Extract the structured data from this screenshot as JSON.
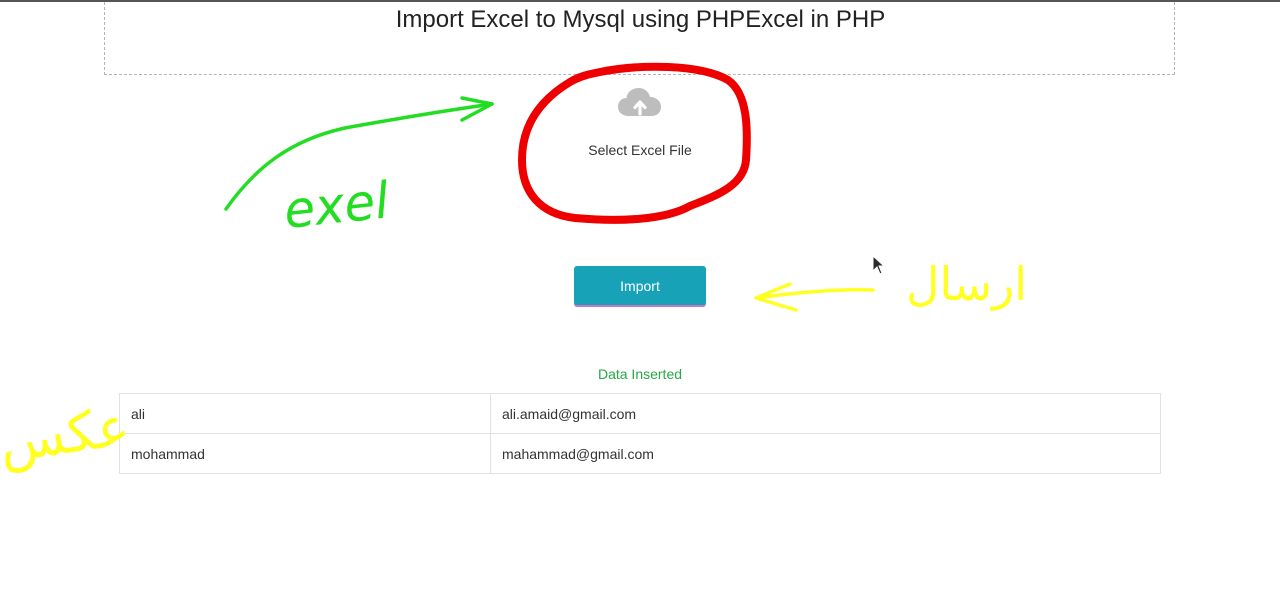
{
  "header": {
    "title": "Import Excel to Mysql using PHPExcel in PHP"
  },
  "upload": {
    "icon": "cloud-upload-icon",
    "label": "Select Excel File"
  },
  "form": {
    "import_label": "Import"
  },
  "result": {
    "status": "Data Inserted",
    "rows": [
      {
        "name": "ali",
        "email": "ali.amaid@gmail.com"
      },
      {
        "name": "mohammad",
        "email": "mahammad@gmail.com"
      }
    ]
  },
  "annotations": {
    "note_exel": "exel",
    "note_send": "ارسال",
    "note_display": "عكس",
    "colors": {
      "green": "#22dd22",
      "red": "#ee0000",
      "yellow": "#ffff22"
    }
  },
  "colors": {
    "button": "#17a2b8",
    "success": "#28a745",
    "title": "#222222"
  }
}
